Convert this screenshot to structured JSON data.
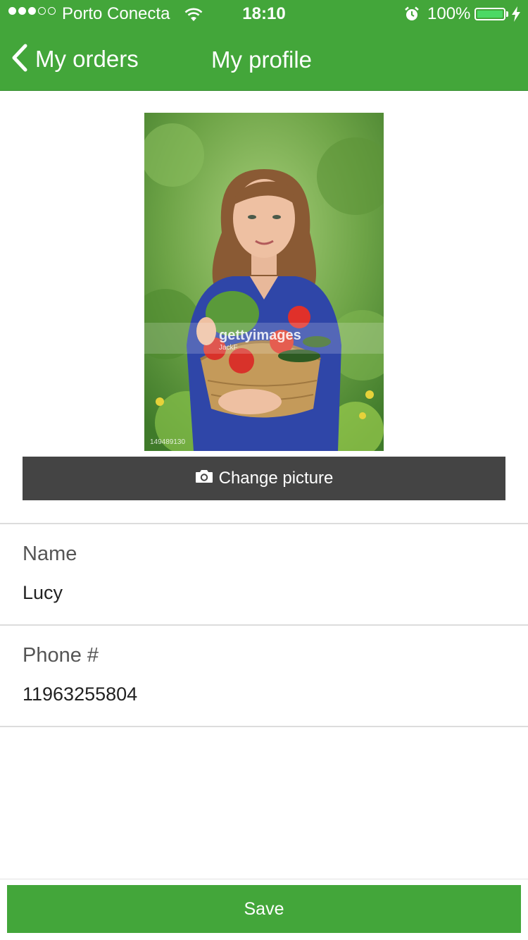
{
  "status_bar": {
    "carrier": "Porto Conecta",
    "time": "18:10",
    "battery": "100%",
    "signal_bars_filled": 3,
    "signal_bars_total": 5
  },
  "nav": {
    "back_label": "My orders",
    "title": "My profile"
  },
  "profile": {
    "photo_watermark": "gettyimages",
    "photo_credit": "JackF",
    "photo_id": "149489130",
    "change_picture_label": "Change picture"
  },
  "fields": {
    "name": {
      "label": "Name",
      "value": "Lucy"
    },
    "phone": {
      "label": "Phone #",
      "value": "11963255804"
    }
  },
  "actions": {
    "save_label": "Save"
  },
  "colors": {
    "primary": "#43a63a",
    "dark_button": "#444444",
    "battery_fill": "#4cd964"
  },
  "icons": [
    "back-chevron-icon",
    "camera-icon",
    "wifi-icon",
    "alarm-icon",
    "battery-icon",
    "charging-bolt-icon"
  ]
}
